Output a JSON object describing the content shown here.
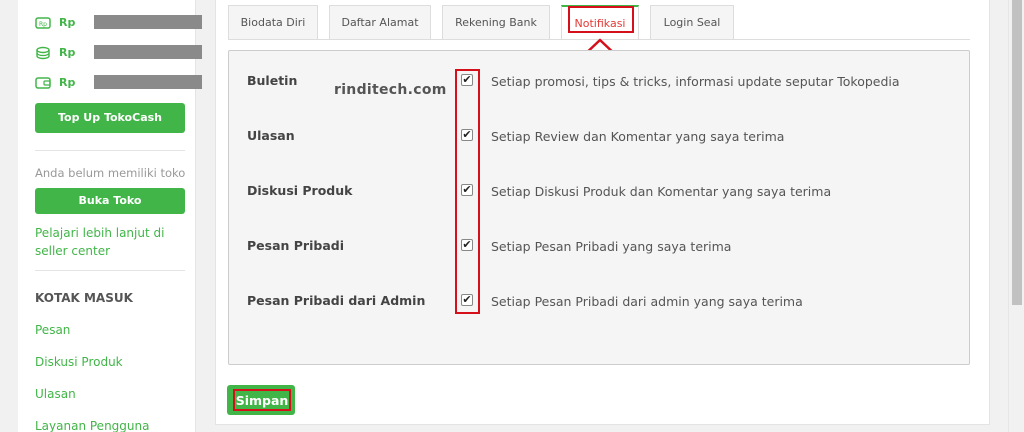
{
  "sidebar": {
    "balances": [
      {
        "icon": "tokocash-icon",
        "currency": "Rp"
      },
      {
        "icon": "coins-icon",
        "currency": "Rp"
      },
      {
        "icon": "wallet-icon",
        "currency": "Rp"
      }
    ],
    "topup_label": "Top Up TokoCash",
    "no_shop_text": "Anda belum memiliki toko",
    "open_shop_label": "Buka Toko",
    "seller_center_link": "Pelajari lebih lanjut di seller center",
    "inbox_heading": "KOTAK MASUK",
    "inbox_items": [
      "Pesan",
      "Diskusi Produk",
      "Ulasan",
      "Layanan Pengguna"
    ]
  },
  "tabs": [
    "Biodata Diri",
    "Daftar Alamat",
    "Rekening Bank",
    "Notifikasi",
    "Login Seal"
  ],
  "active_tab": "Notifikasi",
  "watermark": "rinditech.com",
  "settings": [
    {
      "label": "Buletin",
      "description": "Setiap promosi, tips & tricks, informasi update seputar Tokopedia",
      "checked": true
    },
    {
      "label": "Ulasan",
      "description": "Setiap Review dan Komentar yang saya terima",
      "checked": true
    },
    {
      "label": "Diskusi Produk",
      "description": "Setiap Diskusi Produk dan Komentar yang saya terima",
      "checked": true
    },
    {
      "label": "Pesan Pribadi",
      "description": "Setiap Pesan Pribadi yang saya terima",
      "checked": true
    },
    {
      "label": "Pesan Pribadi dari Admin",
      "description": "Setiap Pesan Pribadi dari admin yang saya terima",
      "checked": true
    }
  ],
  "save_label": "Simpan",
  "colors": {
    "accent": "#42b549",
    "highlight": "#d5101b"
  }
}
